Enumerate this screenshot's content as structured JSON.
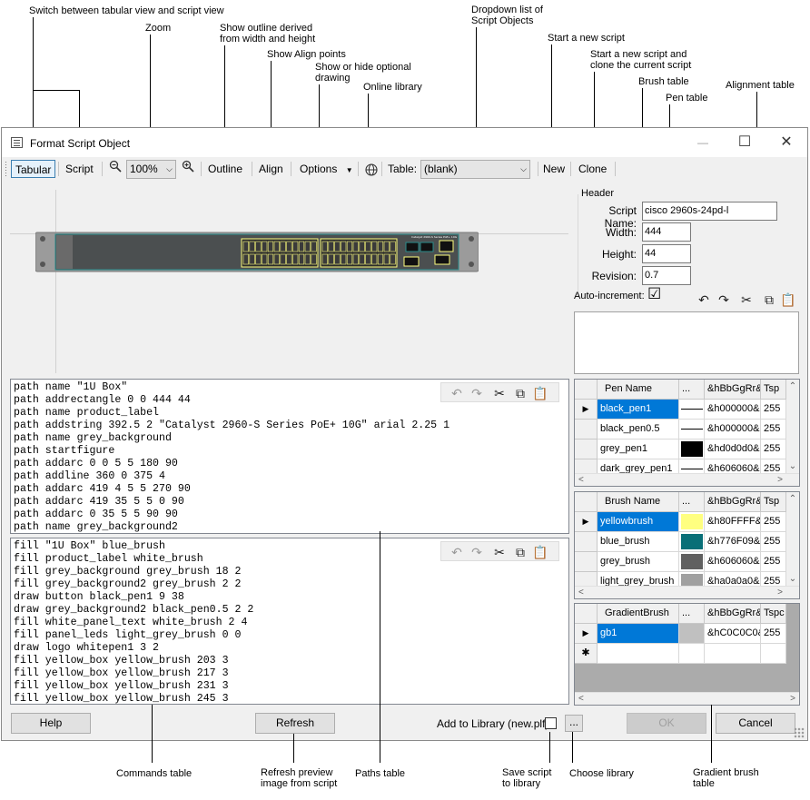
{
  "annotations": {
    "switch_view": "Switch between tabular view and script view",
    "zoom": "Zoom",
    "outline": [
      "Show outline derived",
      "from width and height"
    ],
    "align": "Show Align points",
    "options": [
      "Show or hide optional",
      "drawing"
    ],
    "online_library": "Online library",
    "dropdown": [
      "Dropdown list of",
      "Script Objects"
    ],
    "new_script": "Start a new script",
    "clone_script": [
      "Start a new script and",
      "clone the current script"
    ],
    "brush_table": "Brush table",
    "pen_table": "Pen table",
    "alignment_table": "Alignment table",
    "commands_table": "Commands table",
    "refresh": [
      "Refresh preview",
      "image from script"
    ],
    "paths_table": "Paths table",
    "save_script": [
      "Save script",
      "to library"
    ],
    "choose_library": "Choose library",
    "gradient_table": [
      "Gradient brush",
      "table"
    ]
  },
  "window": {
    "title": "Format Script Object",
    "minimize": "—",
    "maximize": "☐",
    "close": "✕"
  },
  "toolbar": {
    "tabular": "Tabular",
    "script": "Script",
    "zoom_value": "100%",
    "outline": "Outline",
    "align": "Align",
    "options": "Options",
    "table_label": "Table:",
    "table_value": "(blank)",
    "new": "New",
    "clone": "Clone"
  },
  "preview": {
    "device_label": "Catalyst 2960-S Series PoE+ 10G"
  },
  "header": {
    "group_label": "Header",
    "script_name_label": "Script Name:",
    "script_name": "cisco 2960s-24pd-l",
    "width_label": "Width:",
    "width": "444",
    "height_label": "Height:",
    "height": "44",
    "revision_label": "Revision:",
    "revision": "0.7",
    "auto_increment_label": "Auto-increment:",
    "auto_increment_checked": "☑"
  },
  "paths_code": "path name \"1U Box\"\npath addrectangle 0 0 444 44\npath name product_label\npath addstring 392.5 2 \"Catalyst 2960-S Series PoE+ 10G\" arial 2.25 1\npath name grey_background\npath startfigure\npath addarc 0 0 5 5 180 90\npath addline 360 0 375 4\npath addarc 419 4 5 5 270 90\npath addarc 419 35 5 5 0 90\npath addarc 0 35 5 5 90 90\npath name grey_background2",
  "commands_code": "fill \"1U Box\" blue_brush\nfill product_label white_brush\nfill grey_background grey_brush 18 2\nfill grey_background2 grey_brush 2 2\ndraw button black_pen1 9 38\ndraw grey_background2 black_pen0.5 2 2\nfill white_panel_text white_brush 2 4\nfill panel_leds light_grey_brush 0 0\ndraw logo whitepen1 3 2\nfill yellow_box yellow_brush 203 3\nfill yellow_box yellow_brush 217 3\nfill yellow_box yellow_brush 231 3\nfill yellow_box yellow_brush 245 3",
  "pen_table": {
    "columns": [
      "Pen Name",
      "...",
      "&hBbGgRr&",
      "Tsp"
    ],
    "rows": [
      {
        "name": "black_pen1",
        "color": "&h000000&",
        "tsp": "255",
        "swatch": "#000000",
        "style": "line"
      },
      {
        "name": "black_pen0.5",
        "color": "&h000000&",
        "tsp": "255",
        "swatch": "#000000",
        "style": "line"
      },
      {
        "name": "grey_pen1",
        "color": "&hd0d0d0&",
        "tsp": "255",
        "swatch": "#000000",
        "style": "fill"
      },
      {
        "name": "dark_grey_pen1",
        "color": "&h606060&",
        "tsp": "255",
        "swatch": "#000000",
        "style": "line"
      }
    ]
  },
  "brush_table": {
    "columns": [
      "Brush Name",
      "...",
      "&hBbGgRr&",
      "Tsp"
    ],
    "rows": [
      {
        "name": "yellowbrush",
        "color": "&h80FFFF&",
        "tsp": "255",
        "swatch": "#ffff80"
      },
      {
        "name": "blue_brush",
        "color": "&h776F09&",
        "tsp": "255",
        "swatch": "#096f77"
      },
      {
        "name": "grey_brush",
        "color": "&h606060&",
        "tsp": "255",
        "swatch": "#606060"
      },
      {
        "name": "light_grey_brush",
        "color": "&ha0a0a0&",
        "tsp": "255",
        "swatch": "#a0a0a0"
      }
    ]
  },
  "gradient_table": {
    "columns": [
      "GradientBrush",
      "...",
      "&hBbGgRr&",
      "Tspc"
    ],
    "rows": [
      {
        "name": "gb1",
        "color": "&hC0C0C0&",
        "tsp": "255",
        "swatch": "#c0c0c0"
      }
    ],
    "new_row_marker": "✱"
  },
  "bottom": {
    "help": "Help",
    "refresh": "Refresh",
    "add_to_library": "Add to Library (new.plf):",
    "browse": "...",
    "ok": "OK",
    "cancel": "Cancel"
  }
}
